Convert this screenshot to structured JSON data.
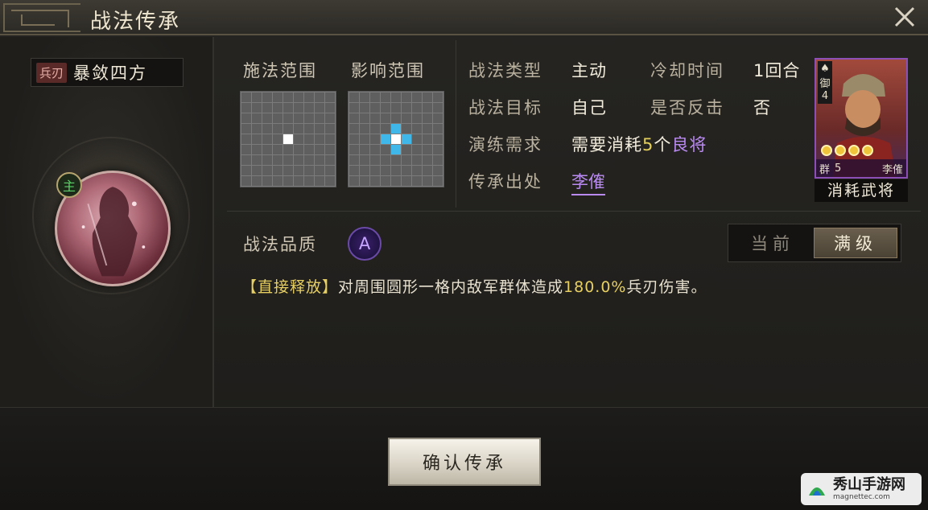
{
  "window": {
    "title": "战法传承",
    "close_icon": "close-icon"
  },
  "skill": {
    "type_tag": "兵刃",
    "name": "暴敛四方",
    "main_badge": "主"
  },
  "ranges": {
    "cast_label": "施法范围",
    "effect_label": "影响范围"
  },
  "info": {
    "type_label": "战法类型",
    "type_value": "主动",
    "cooldown_label": "冷却时间",
    "cooldown_value": "1回合",
    "target_label": "战法目标",
    "target_value": "自己",
    "counter_label": "是否反击",
    "counter_value": "否",
    "require_label": "演练需求",
    "require_prefix": "需要消耗",
    "require_count": "5",
    "require_unit": "个",
    "require_quality": "良将",
    "source_label": "传承出处",
    "source_value": "李傕"
  },
  "general_card": {
    "side_tag": "御",
    "level": "4",
    "faction": "群",
    "cost": "5",
    "name": "李傕",
    "stars": 4,
    "caption": "消耗武将"
  },
  "quality": {
    "label": "战法品质",
    "grade": "A",
    "toggle_current": "当前",
    "toggle_max": "满级"
  },
  "description": {
    "tag": "【直接释放】",
    "text_before": "对周围圆形一格内敌军群体造成",
    "percent": "180.0%",
    "text_after": "兵刃伤害。"
  },
  "actions": {
    "confirm_label": "确认传承"
  },
  "watermark": {
    "cn": "秀山手游网",
    "en": "magnettec.com"
  },
  "colors": {
    "accent_yellow": "#e3cf5a",
    "accent_purple": "#b98af0",
    "highlight_blue": "#3fb7e8"
  }
}
